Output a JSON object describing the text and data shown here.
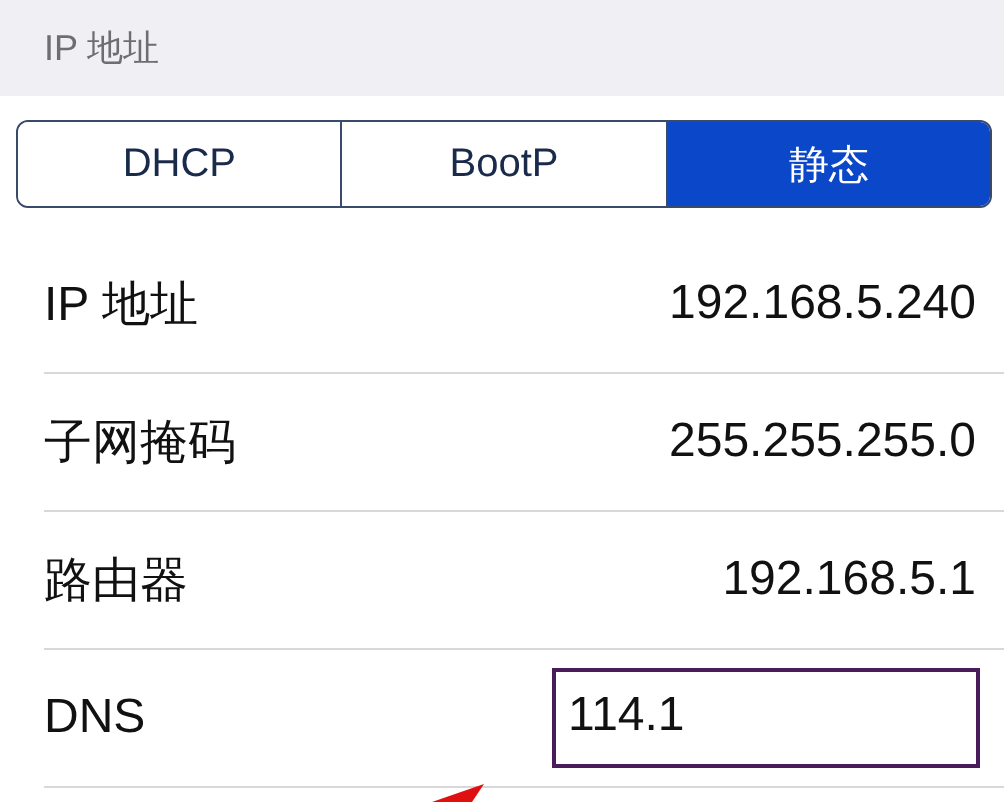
{
  "section_header": "IP 地址",
  "segments": [
    {
      "label": "DHCP",
      "selected": false
    },
    {
      "label": "BootP",
      "selected": false
    },
    {
      "label": "静态",
      "selected": true
    }
  ],
  "rows": [
    {
      "label": "IP 地址",
      "value": "192.168.5.240",
      "highlighted": false
    },
    {
      "label": "子网掩码",
      "value": "255.255.255.0",
      "highlighted": false
    },
    {
      "label": "路由器",
      "value": "192.168.5.1",
      "highlighted": false
    },
    {
      "label": "DNS",
      "value": "114.1",
      "highlighted": true
    }
  ]
}
